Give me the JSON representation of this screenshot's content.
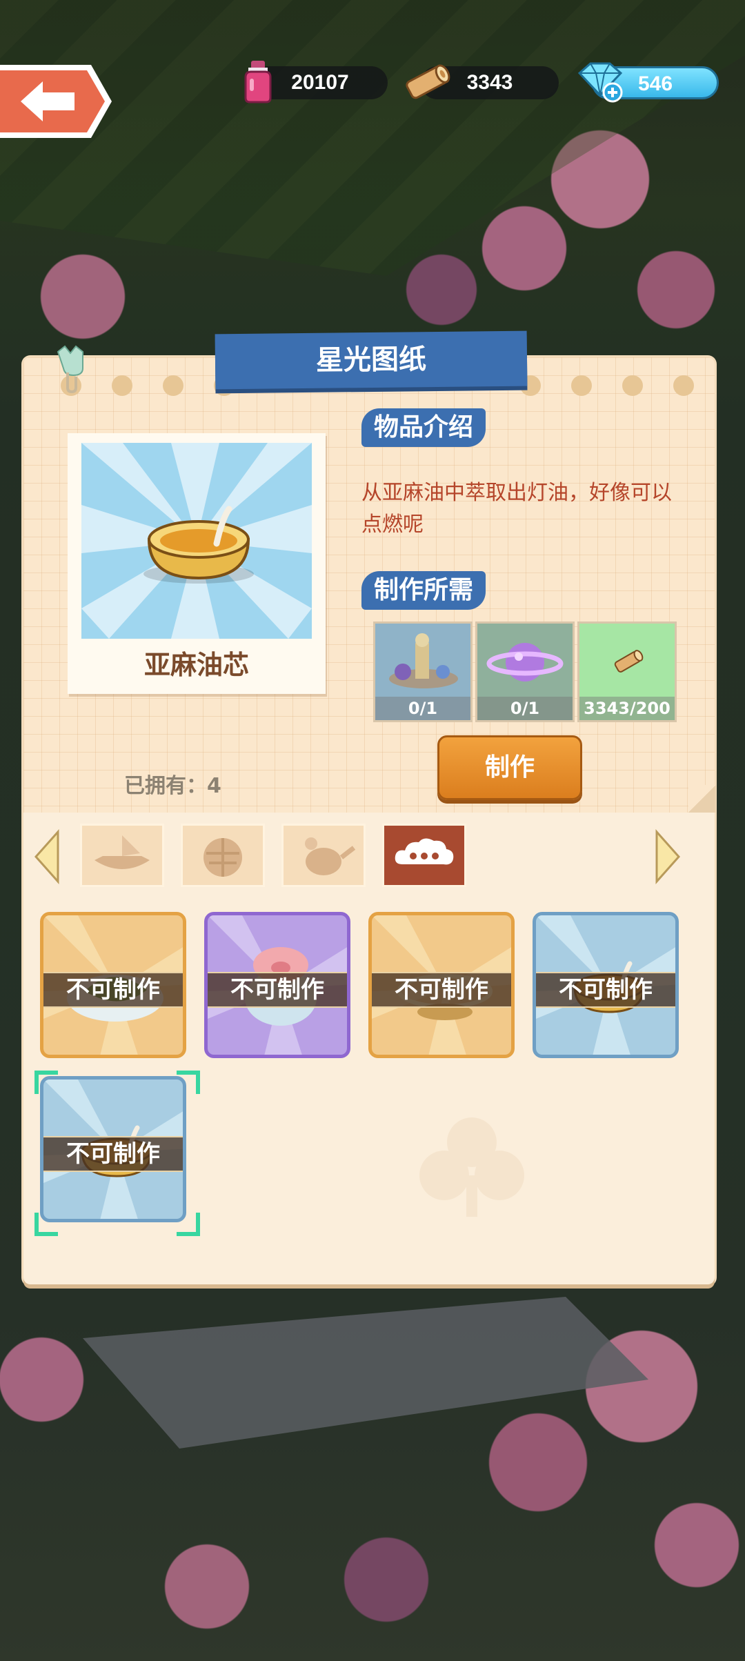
{
  "top_bar": {
    "potion_count": "20107",
    "wood_count": "3343",
    "gem_count": "546"
  },
  "panel": {
    "title": "星光图纸",
    "item": {
      "name": "亚麻油芯",
      "owned_label": "已拥有：4"
    },
    "intro": {
      "label": "物品介绍",
      "text": "从亚麻油中萃取出灯油，好像可以点燃呢"
    },
    "requirements": {
      "label": "制作所需",
      "items": [
        {
          "icon": "fountain-decor-icon",
          "count": "0/1"
        },
        {
          "icon": "planet-decor-icon",
          "count": "0/1"
        },
        {
          "icon": "wood-icon",
          "count": "3343/200"
        }
      ]
    },
    "make_button": "制作",
    "tabs": [
      {
        "icon": "boat-icon",
        "active": false
      },
      {
        "icon": "basket-icon",
        "active": false
      },
      {
        "icon": "teapot-icon",
        "active": false
      },
      {
        "icon": "more-icon",
        "active": true
      }
    ],
    "grid": [
      {
        "icon": "leaf-plate-icon",
        "frame": "gold",
        "status": "不可制作"
      },
      {
        "icon": "pig-bowl-icon",
        "frame": "purple",
        "status": "不可制作"
      },
      {
        "icon": "magic-ring-icon",
        "frame": "gold",
        "status": "不可制作"
      },
      {
        "icon": "oil-lamp-icon",
        "frame": "blue",
        "status": "不可制作"
      },
      {
        "icon": "oil-lamp-icon",
        "frame": "blue",
        "status": "不可制作",
        "selected": true
      }
    ]
  }
}
